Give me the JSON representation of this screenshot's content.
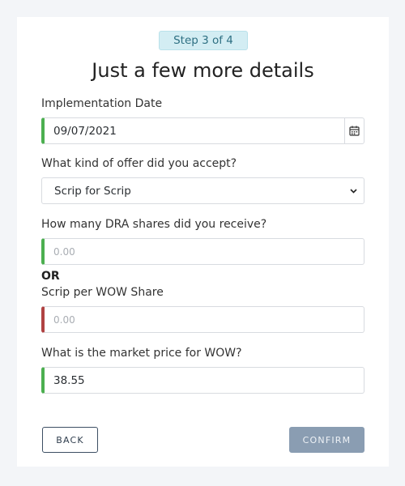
{
  "step": {
    "label": "Step 3 of 4"
  },
  "title": "Just a few more details",
  "fields": {
    "implementation_date": {
      "label": "Implementation Date",
      "value": "09/07/2021"
    },
    "offer_type": {
      "label": "What kind of offer did you accept?",
      "selected": "Scrip for Scrip"
    },
    "dra_shares": {
      "label": "How many DRA shares did you receive?",
      "placeholder": "0.00",
      "value": ""
    },
    "or_label": "OR",
    "scrip_per_share": {
      "label": "Scrip per WOW Share",
      "placeholder": "0.00",
      "value": ""
    },
    "market_price": {
      "label": "What is the market price for WOW?",
      "value": "38.55"
    }
  },
  "buttons": {
    "back": "BACK",
    "confirm": "CONFIRM"
  },
  "colors": {
    "valid": "#4caf50",
    "invalid": "#b04242",
    "badge_bg": "#d3edf3",
    "confirm_bg": "#8a9db2"
  }
}
